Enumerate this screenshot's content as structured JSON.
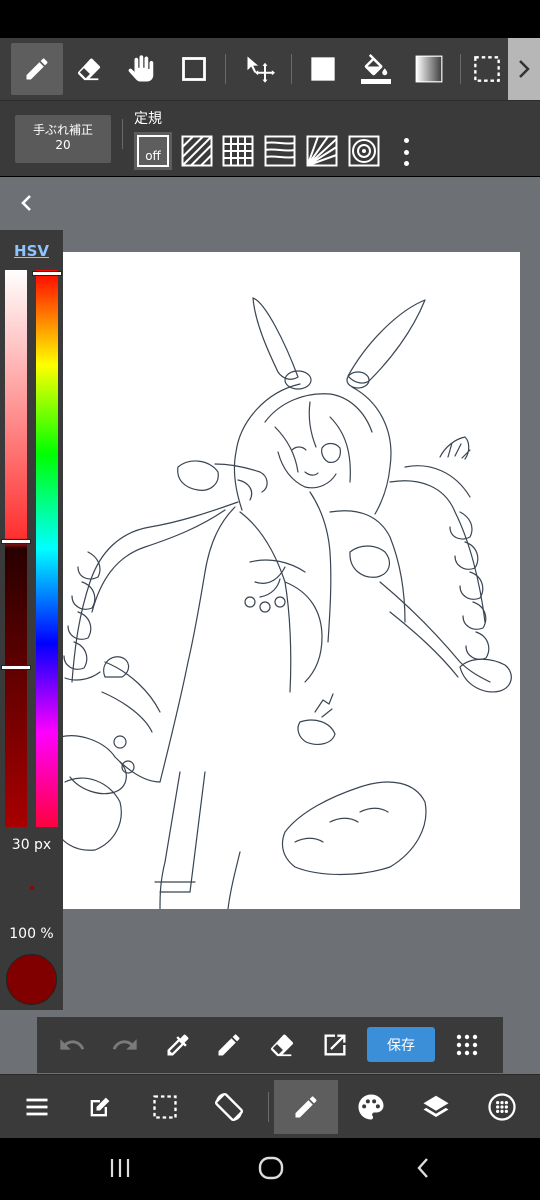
{
  "toolbar": {
    "tools": [
      "pen-tool",
      "eraser-tool",
      "hand-tool",
      "shape-tool",
      "move-tool",
      "fill-rect-tool",
      "bucket-tool",
      "gradient-tool",
      "selection-tool"
    ],
    "active_tool": "pen-tool"
  },
  "subbar": {
    "stabilizer_label": "手ぶれ補正",
    "stabilizer_value": "20",
    "ruler_label": "定規",
    "ruler_off_label": "off"
  },
  "color_panel": {
    "mode_label": "HSV",
    "brush_size": "30 px",
    "opacity": "100 %",
    "current_color": "#800000"
  },
  "actionbar": {
    "save_label": "保存"
  },
  "bottombar": {
    "active_item": "brush"
  },
  "colors": {
    "accent": "#3b8fd9",
    "toolbar_bg": "#3d3d3d",
    "workspace_bg": "#6d7175"
  }
}
